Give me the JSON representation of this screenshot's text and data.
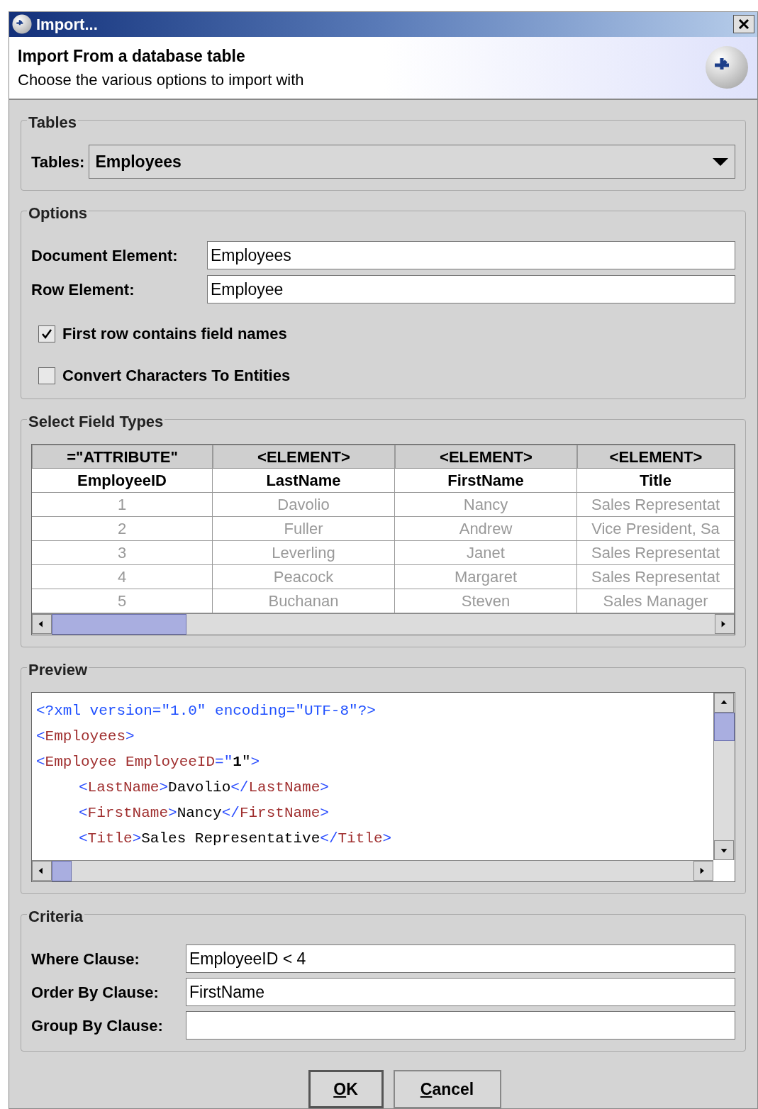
{
  "window": {
    "title": "Import..."
  },
  "header": {
    "title": "Import From a database table",
    "subtitle": "Choose the various options to import with"
  },
  "tables_group": {
    "legend": "Tables",
    "label": "Tables:",
    "value": "Employees"
  },
  "options_group": {
    "legend": "Options",
    "fields": [
      {
        "label": "Document Element:",
        "value": "Employees"
      },
      {
        "label": "Row Element:",
        "value": "Employee"
      }
    ],
    "checkboxes": [
      {
        "label": "First row contains field names",
        "checked": true
      },
      {
        "label": "Convert Characters To Entities",
        "checked": false
      }
    ]
  },
  "field_types": {
    "legend": "Select Field Types",
    "columns": [
      {
        "type": "=\"ATTRIBUTE\"",
        "name": "EmployeeID"
      },
      {
        "type": "<ELEMENT>",
        "name": "LastName"
      },
      {
        "type": "<ELEMENT>",
        "name": "FirstName"
      },
      {
        "type": "<ELEMENT>",
        "name": "Title"
      }
    ],
    "rows": [
      [
        "1",
        "Davolio",
        "Nancy",
        "Sales Representat"
      ],
      [
        "2",
        "Fuller",
        "Andrew",
        "Vice President, Sa"
      ],
      [
        "3",
        "Leverling",
        "Janet",
        "Sales Representat"
      ],
      [
        "4",
        "Peacock",
        "Margaret",
        "Sales Representat"
      ],
      [
        "5",
        "Buchanan",
        "Steven",
        "Sales Manager"
      ]
    ]
  },
  "preview": {
    "legend": "Preview",
    "lines": [
      {
        "segments": [
          {
            "kind": "decl",
            "text": "<?xml version=\"1.0\" encoding=\"UTF-8\"?>"
          }
        ]
      },
      {
        "segments": [
          {
            "kind": "punct",
            "text": "<"
          },
          {
            "kind": "tag",
            "text": "Employees"
          },
          {
            "kind": "punct",
            "text": ">"
          }
        ]
      },
      {
        "segments": [
          {
            "kind": "punct",
            "text": "<"
          },
          {
            "kind": "tag",
            "text": "Employee EmployeeID"
          },
          {
            "kind": "punct",
            "text": "=\""
          },
          {
            "kind": "value",
            "text": "1"
          },
          {
            "kind": "text",
            "text": "\""
          },
          {
            "kind": "punct",
            "text": ">"
          }
        ],
        "children": [
          {
            "segments": [
              {
                "kind": "punct",
                "text": "<"
              },
              {
                "kind": "tag",
                "text": "LastName"
              },
              {
                "kind": "punct",
                "text": ">"
              },
              {
                "kind": "text",
                "text": "Davolio"
              },
              {
                "kind": "punct",
                "text": "</"
              },
              {
                "kind": "tag",
                "text": "LastName"
              },
              {
                "kind": "punct",
                "text": ">"
              }
            ]
          },
          {
            "segments": [
              {
                "kind": "punct",
                "text": "<"
              },
              {
                "kind": "tag",
                "text": "FirstName"
              },
              {
                "kind": "punct",
                "text": ">"
              },
              {
                "kind": "text",
                "text": "Nancy"
              },
              {
                "kind": "punct",
                "text": "</"
              },
              {
                "kind": "tag",
                "text": "FirstName"
              },
              {
                "kind": "punct",
                "text": ">"
              }
            ]
          },
          {
            "segments": [
              {
                "kind": "punct",
                "text": "<"
              },
              {
                "kind": "tag",
                "text": "Title"
              },
              {
                "kind": "punct",
                "text": ">"
              },
              {
                "kind": "text",
                "text": "Sales Representative"
              },
              {
                "kind": "punct",
                "text": "</"
              },
              {
                "kind": "tag",
                "text": "Title"
              },
              {
                "kind": "punct",
                "text": ">"
              }
            ]
          }
        ]
      }
    ]
  },
  "criteria": {
    "legend": "Criteria",
    "fields": [
      {
        "label": "Where Clause:",
        "value": "EmployeeID < 4"
      },
      {
        "label": "Order By Clause:",
        "value": "FirstName"
      },
      {
        "label": "Group By Clause:"
      }
    ]
  },
  "buttons": [
    {
      "label": "OK",
      "default": true
    },
    {
      "label": "Cancel",
      "default": false
    }
  ]
}
